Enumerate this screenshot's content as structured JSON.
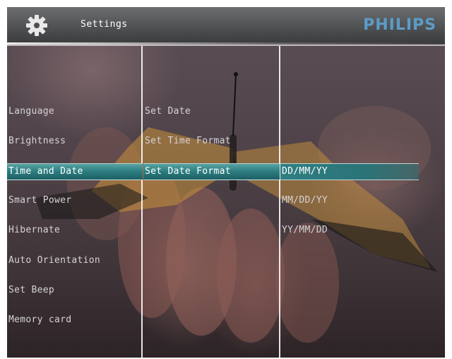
{
  "header": {
    "title": "Settings",
    "brand": "PHILIPS",
    "icon": "gear-icon"
  },
  "columns": {
    "settings": [
      {
        "label": "Language",
        "selected": false
      },
      {
        "label": "Brightness",
        "selected": false
      },
      {
        "label": "Time and Date",
        "selected": true
      },
      {
        "label": "Smart Power",
        "selected": false
      },
      {
        "label": "Hibernate",
        "selected": false
      },
      {
        "label": "Auto Orientation",
        "selected": false
      },
      {
        "label": "Set Beep",
        "selected": false
      },
      {
        "label": "Memory card",
        "selected": false
      }
    ],
    "time_and_date": [
      {
        "label": "Set Date",
        "selected": false
      },
      {
        "label": "Set Time Format",
        "selected": false
      },
      {
        "label": "Set Date Format",
        "selected": true
      }
    ],
    "date_format": [
      {
        "label": "DD/MM/YY",
        "selected": true
      },
      {
        "label": "MM/DD/YY",
        "selected": false
      },
      {
        "label": "YY/MM/DD",
        "selected": false
      }
    ]
  },
  "colors": {
    "highlight": "#2f7f82",
    "brand": "#5b9cc8",
    "text": "#d6d3d6"
  }
}
